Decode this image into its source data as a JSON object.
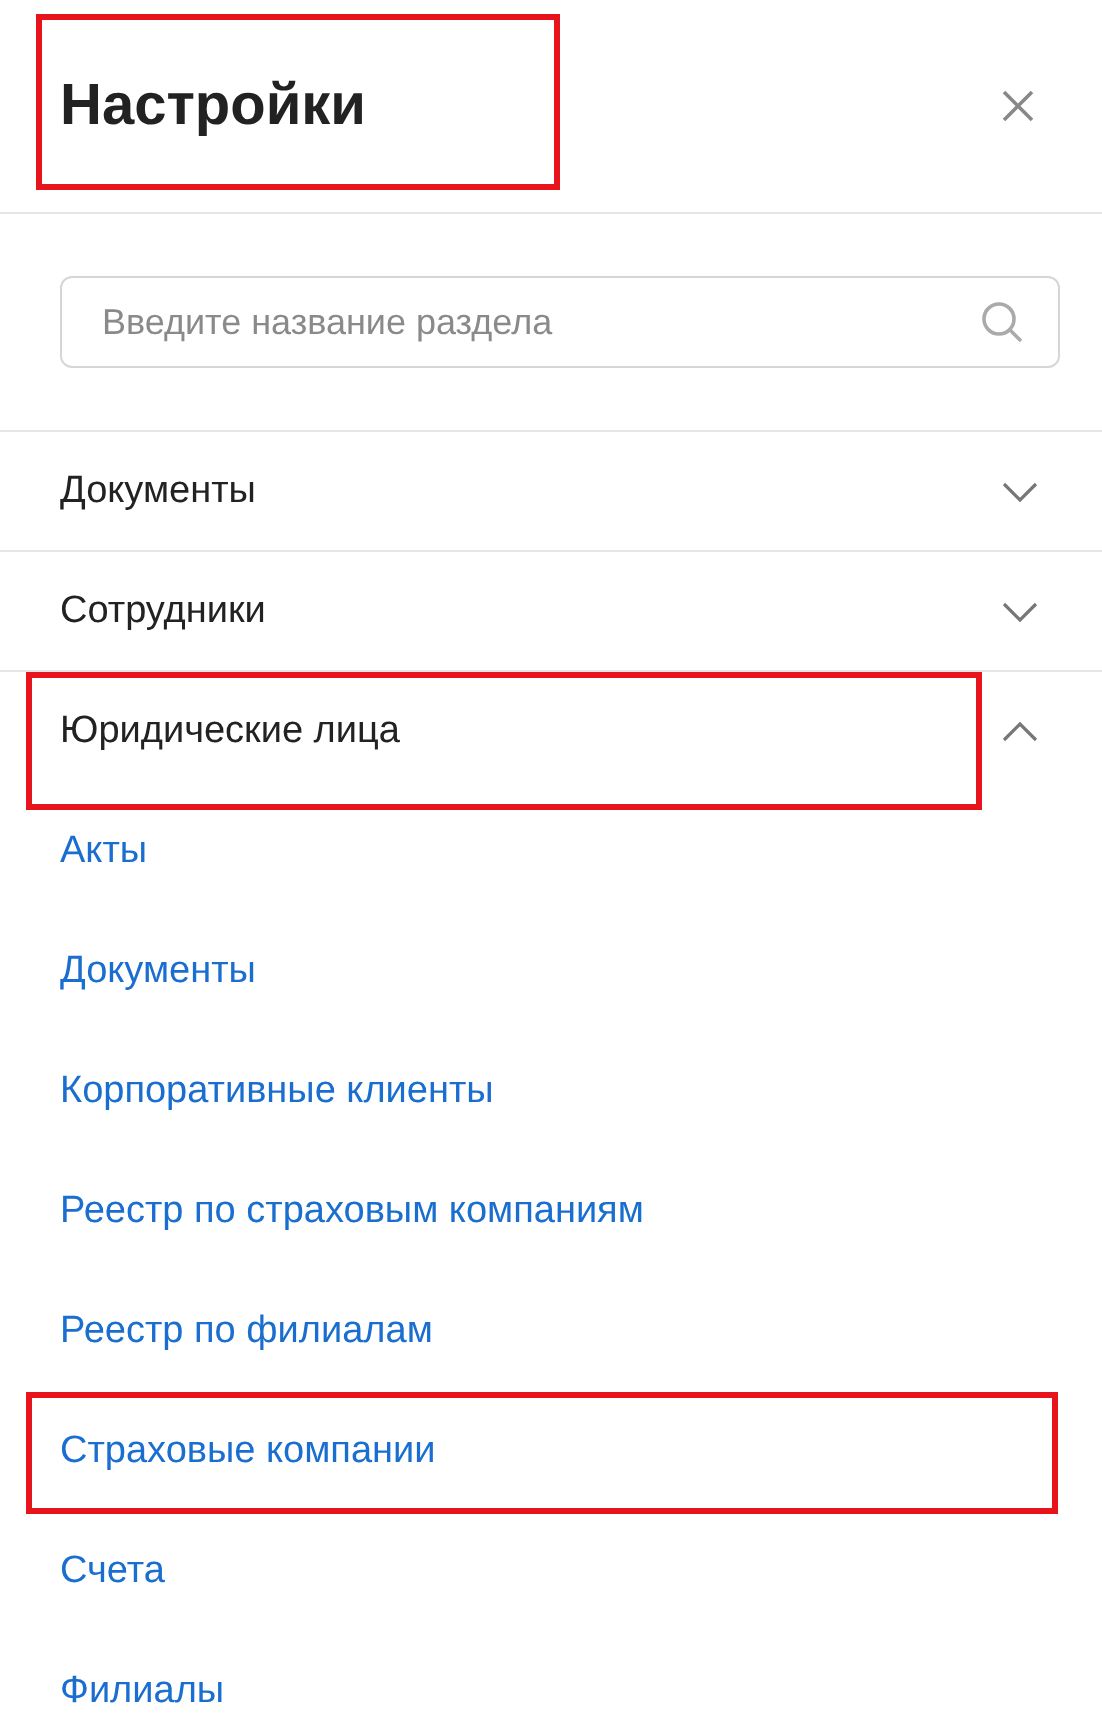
{
  "panel": {
    "title": {
      "text": "Настройки",
      "highlighted": true
    },
    "search": {
      "placeholder": "Введите название раздела"
    },
    "sections": [
      {
        "label": "Документы",
        "expanded": false,
        "highlighted": false
      },
      {
        "label": "Сотрудники",
        "expanded": false,
        "highlighted": false
      },
      {
        "label": "Юридические лица",
        "expanded": true,
        "highlighted": true,
        "children": [
          {
            "label": "Акты",
            "highlighted": false
          },
          {
            "label": "Документы",
            "highlighted": false
          },
          {
            "label": "Корпоративные клиенты",
            "highlighted": false
          },
          {
            "label": "Реестр по страховым компаниям",
            "highlighted": false
          },
          {
            "label": "Реестр по филиалам",
            "highlighted": false
          },
          {
            "label": "Страховые компании",
            "highlighted": true
          },
          {
            "label": "Счета",
            "highlighted": false
          },
          {
            "label": "Филиалы",
            "highlighted": false
          }
        ]
      }
    ]
  }
}
